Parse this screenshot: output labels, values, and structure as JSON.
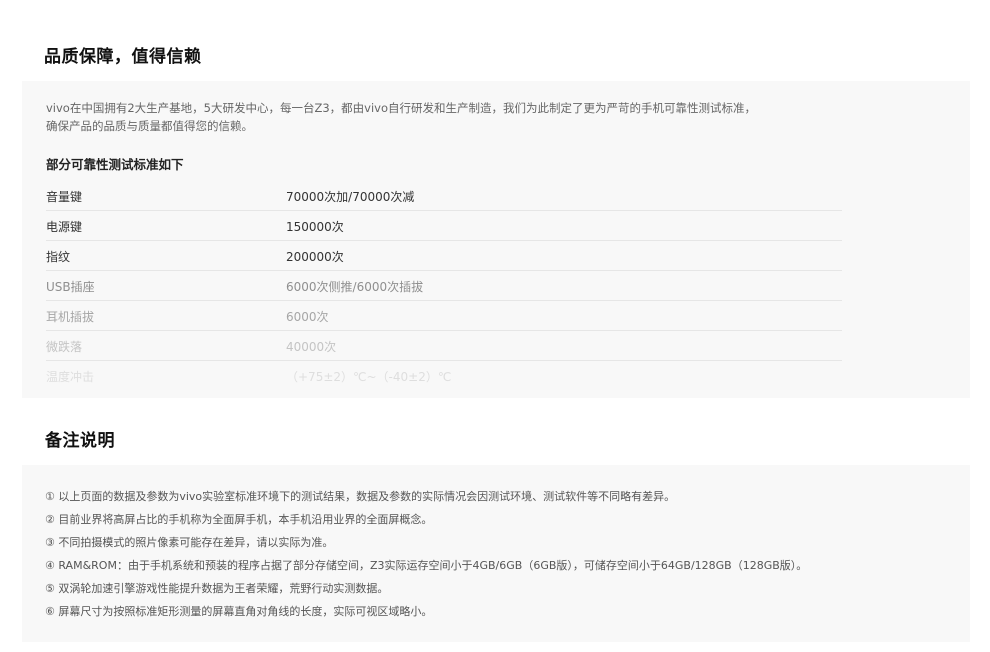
{
  "quality": {
    "title": "品质保障，值得信赖",
    "intro_line1": "vivo在中国拥有2大生产基地，5大研发中心，每一台Z3，都由vivo自行研发和生产制造，我们为此制定了更为严苛的手机可靠性测试标准，",
    "intro_line2": "确保产品的品质与质量都值得您的信赖。",
    "standards_heading": "部分可靠性测试标准如下",
    "standards": [
      {
        "item": "音量键",
        "value": "70000次加/70000次减"
      },
      {
        "item": "电源键",
        "value": "150000次"
      },
      {
        "item": "指纹",
        "value": "200000次"
      },
      {
        "item": "USB插座",
        "value": "6000次侧推/6000次插拔"
      },
      {
        "item": "耳机插拔",
        "value": "6000次"
      },
      {
        "item": "微跌落",
        "value": "40000次"
      },
      {
        "item": "温度冲击",
        "value": "（+75±2）℃~（-40±2）℃"
      }
    ]
  },
  "notes": {
    "title": "备注说明",
    "items": [
      "① 以上页面的数据及参数为vivo实验室标准环境下的测试结果，数据及参数的实际情况会因测试环境、测试软件等不同略有差异。",
      "② 目前业界将高屏占比的手机称为全面屏手机，本手机沿用业界的全面屏概念。",
      "③ 不同拍摄模式的照片像素可能存在差异，请以实际为准。",
      "④ RAM&ROM：由于手机系统和预装的程序占据了部分存储空间，Z3实际运存空间小于4GB/6GB（6GB版），可储存空间小于64GB/128GB（128GB版）。",
      "⑤ 双涡轮加速引擎游戏性能提升数据为王者荣耀，荒野行动实测数据。",
      "⑥ 屏幕尺寸为按照标准矩形测量的屏幕直角对角线的长度，实际可视区域略小。"
    ]
  }
}
